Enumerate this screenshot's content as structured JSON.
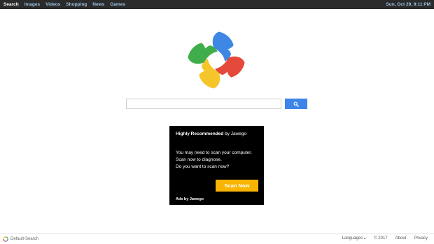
{
  "nav": {
    "items": [
      {
        "label": "Search",
        "active": true
      },
      {
        "label": "Images",
        "active": false
      },
      {
        "label": "Videos",
        "active": false
      },
      {
        "label": "Shopping",
        "active": false
      },
      {
        "label": "News",
        "active": false
      },
      {
        "label": "Games",
        "active": false
      }
    ],
    "datetime": "Sun, Oct 29, 9:11 PM"
  },
  "search": {
    "value": "",
    "placeholder": "",
    "button_icon": "search-icon"
  },
  "ad": {
    "heading_bold": "Highly Recommended",
    "heading_rest": " by Jawego",
    "lines": [
      "You may need to scan your computer.",
      "Scan now to diagnose.",
      "Do you want to scan now?"
    ],
    "button_label": "Scan Now",
    "ads_by": "Ads by Jawego"
  },
  "footer": {
    "brand": "Default-Search",
    "languages": "Languages",
    "copyright": "© 2017",
    "about": "About",
    "privacy": "Privacy"
  },
  "colors": {
    "topbar": "#2b2b2b",
    "nav_link": "#9fc3e7",
    "search_button": "#3d86e7",
    "scan_button": "#f8b400",
    "logo_blue": "#3f87e5",
    "logo_red": "#e5493b",
    "logo_yellow": "#f5c52a",
    "logo_green": "#3fae4a"
  }
}
